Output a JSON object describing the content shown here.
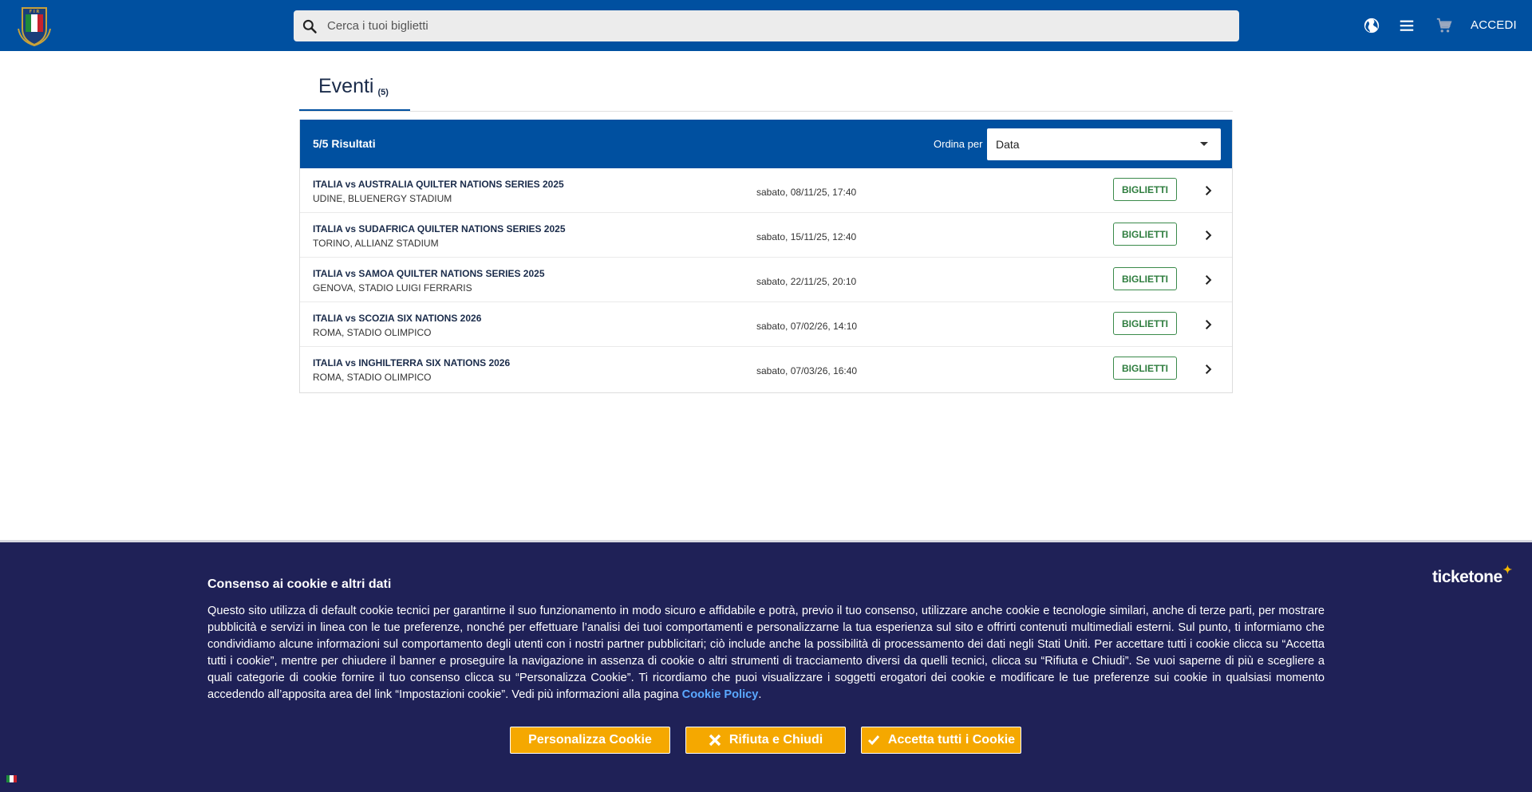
{
  "header": {
    "logo_icon": "fir-rugby-shield-logo",
    "search_placeholder": "Cerca i tuoi biglietti",
    "language_icon": "globe-icon",
    "menu_icon": "hamburger-menu-icon",
    "cart_icon": "shopping-cart-icon",
    "login_label": "ACCEDI"
  },
  "tabs": {
    "events_label": "Eventi",
    "events_count": "(5)"
  },
  "results": {
    "count_label": "5/5 Risultati",
    "sort_label": "Ordina per",
    "sort_value": "Data",
    "ticket_button_label": "BIGLIETTI",
    "events": [
      {
        "title": "ITALIA vs AUSTRALIA QUILTER NATIONS SERIES 2025",
        "venue": "UDINE, BLUENERGY STADIUM",
        "date": "sabato, 08/11/25, 17:40"
      },
      {
        "title": "ITALIA vs SUDAFRICA QUILTER NATIONS SERIES 2025",
        "venue": "TORINO, ALLIANZ STADIUM",
        "date": "sabato, 15/11/25, 12:40"
      },
      {
        "title": "ITALIA vs SAMOA QUILTER NATIONS SERIES 2025",
        "venue": "GENOVA, STADIO LUIGI FERRARIS",
        "date": "sabato, 22/11/25, 20:10"
      },
      {
        "title": "ITALIA vs SCOZIA SIX NATIONS 2026",
        "venue": "ROMA, STADIO OLIMPICO",
        "date": "sabato, 07/02/26, 14:10"
      },
      {
        "title": "ITALIA vs INGHILTERRA SIX NATIONS 2026",
        "venue": "ROMA, STADIO OLIMPICO",
        "date": "sabato, 07/03/26, 16:40"
      }
    ]
  },
  "cookie": {
    "title": "Consenso ai cookie e altri dati",
    "text": "Questo sito utilizza di default cookie tecnici per garantirne il suo funzionamento in modo sicuro e affidabile e potrà, previo il tuo consenso, utilizzare anche cookie e tecnologie similari, anche di terze parti, per mostrare pubblicità e servizi in linea con le tue preferenze, nonché per effettuare l’analisi dei tuoi comportamenti e personalizzarne la tua esperienza sul sito e offrirti contenuti multimediali esterni. Sul punto, ti informiamo che condividiamo alcune informazioni sul comportamento degli utenti con i nostri partner pubblicitari; ciò include anche la possibilità di processamento dei dati negli Stati Uniti. Per accettare tutti i cookie clicca su “Accetta tutti i cookie”, mentre per chiudere il banner e proseguire la navigazione in assenza di cookie o altri strumenti di tracciamento diversi da quelli tecnici, clicca su “Rifiuta e Chiudi”. Se vuoi saperne di più e scegliere a quali categorie di cookie fornire il tuo consenso clicca su “Personalizza Cookie”. Ti ricordiamo che puoi visualizzare i soggetti erogatori dei cookie e modificare le tue preferenze sui cookie in qualsiasi momento accedendo all’apposita area del link “Impostazioni cookie”. Vedi più informazioni alla pagina ",
    "link_label": "Cookie Policy",
    "link_suffix": ".",
    "brand": "ticketone",
    "btn_customize": "Personalizza Cookie",
    "btn_reject": "Rifiuta e Chiudi",
    "btn_accept": "Accetta tutti i Cookie",
    "accent_color": "#f5a800",
    "bg_color": "#1f2157"
  },
  "colors": {
    "primary": "#0050a0",
    "ticket_green": "#2e7d3e"
  },
  "footer": {
    "language_flag_icon": "italian-flag-icon"
  }
}
